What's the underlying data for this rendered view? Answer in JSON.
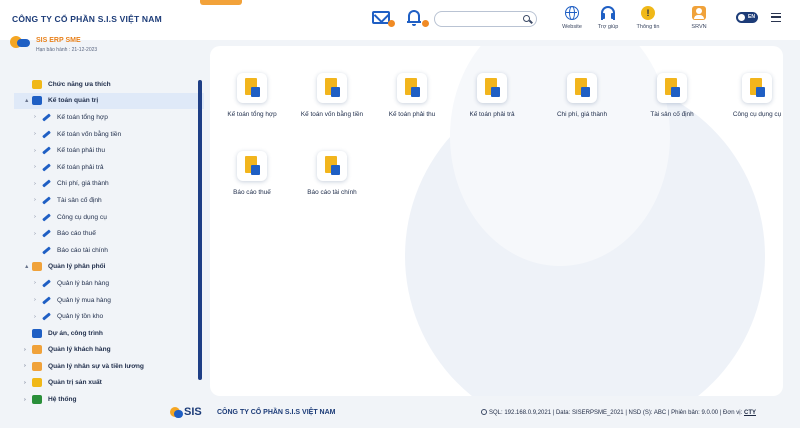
{
  "header": {
    "company": "CÔNG TY CỔ PHẦN S.I.S VIỆT NAM",
    "search_placeholder": "",
    "icons": [
      {
        "name": "website",
        "label": "Website"
      },
      {
        "name": "support",
        "label": "Trợ giúp"
      },
      {
        "name": "info",
        "label": "Thông tin"
      },
      {
        "name": "account",
        "label": "SRVN"
      }
    ],
    "language": "EN"
  },
  "product": {
    "name": "SIS ERP SME",
    "expiry": "Hạn bảo hành : 21-12-2023"
  },
  "sidebar": {
    "items": [
      {
        "label": "Chức năng ưa thích",
        "level": 0,
        "expander": "",
        "icon": "star-icon",
        "color": "#f0b818"
      },
      {
        "label": "Kế toán quản trị",
        "level": 0,
        "expander": "▲",
        "icon": "folder-icon",
        "color": "#1f5fc4",
        "selected": true
      },
      {
        "label": "Kế toán tổng hợp",
        "level": 1,
        "expander": "›",
        "icon": "pen-icon"
      },
      {
        "label": "Kế toán vốn bằng tiền",
        "level": 1,
        "expander": "›",
        "icon": "pen-icon"
      },
      {
        "label": "Kế toán phải thu",
        "level": 1,
        "expander": "›",
        "icon": "pen-icon"
      },
      {
        "label": "Kế toán phải trả",
        "level": 1,
        "expander": "›",
        "icon": "pen-icon"
      },
      {
        "label": "Chi phí, giá thành",
        "level": 1,
        "expander": "›",
        "icon": "pen-icon"
      },
      {
        "label": "Tài sản cố định",
        "level": 1,
        "expander": "›",
        "icon": "pen-icon"
      },
      {
        "label": "Công cụ dụng cụ",
        "level": 1,
        "expander": "›",
        "icon": "pen-icon"
      },
      {
        "label": "Báo cáo thuế",
        "level": 1,
        "expander": "›",
        "icon": "pen-icon"
      },
      {
        "label": "Báo cáo tài chính",
        "level": 1,
        "expander": "",
        "icon": "pen-icon"
      },
      {
        "label": "Quản lý phân phối",
        "level": 0,
        "expander": "▲",
        "icon": "distribution-icon",
        "color": "#f0a23a"
      },
      {
        "label": "Quản lý bán hàng",
        "level": 1,
        "expander": "›",
        "icon": "pen-icon"
      },
      {
        "label": "Quản lý mua hàng",
        "level": 1,
        "expander": "›",
        "icon": "pen-icon"
      },
      {
        "label": "Quản lý tồn kho",
        "level": 1,
        "expander": "›",
        "icon": "pen-icon"
      },
      {
        "label": "Dự án, công trình",
        "level": 0,
        "expander": "",
        "icon": "project-icon",
        "color": "#1f5fc4"
      },
      {
        "label": "Quản lý khách hàng",
        "level": 0,
        "expander": "›",
        "icon": "customers-icon",
        "color": "#f0a23a"
      },
      {
        "label": "Quản lý nhân sự và tiền lương",
        "level": 0,
        "expander": "›",
        "icon": "hr-icon",
        "color": "#f0a23a"
      },
      {
        "label": "Quản trị sản xuất",
        "level": 0,
        "expander": "›",
        "icon": "production-icon",
        "color": "#f0b818"
      },
      {
        "label": "Hệ thống",
        "level": 0,
        "expander": "›",
        "icon": "system-icon",
        "color": "#2a8f3a"
      }
    ]
  },
  "apps": [
    {
      "label": "Kế toán tổng hợp"
    },
    {
      "label": "Kế toán vốn bằng tiền"
    },
    {
      "label": "Kế toán phải thu"
    },
    {
      "label": "Kế toán phải trả"
    },
    {
      "label": "Chi phí, giá thành"
    },
    {
      "label": "Tài sản cố định"
    },
    {
      "label": "Công cụ dụng cụ"
    },
    {
      "label": "Báo cáo thuế"
    },
    {
      "label": "Báo cáo tài chính"
    }
  ],
  "footer": {
    "logo_text": "SIS",
    "company": "CÔNG TY CỔ PHẦN S.I.S VIỆT NAM",
    "status": "SQL: 192.168.0.9,2021 | Data: SISERPSME_2021 | NSD (S): ABC | Phiên bản: 9.0.00 | Đơn vị:",
    "unit": "CTY"
  },
  "colors": {
    "primary": "#1f5fc4",
    "navy": "#1d3c78",
    "accent": "#f0a23a",
    "notification": "#f08a24"
  }
}
